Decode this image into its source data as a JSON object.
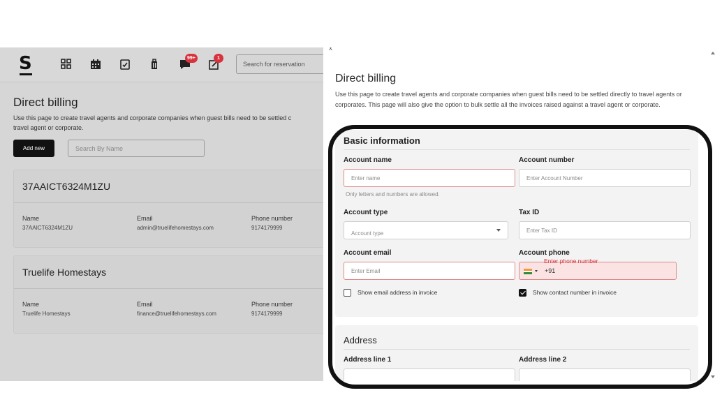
{
  "app": {
    "logo": "S",
    "search_reservation_placeholder": "Search for reservation",
    "nav_badges": {
      "messages": "99+",
      "tasks": "1"
    },
    "title": "Direct billing",
    "description_line1": "Use this page to create travel agents and corporate companies when guest bills need to be settled c",
    "description_line2": "travel agent or corporate.",
    "add_new_label": "Add new",
    "search_name_placeholder": "Search By Name",
    "accounts": [
      {
        "title": "37AAICT6324M1ZU",
        "name_label": "Name",
        "name": "37AAICT6324M1ZU",
        "email_label": "Email",
        "email": "admin@truelifehomestays.com",
        "phone_label": "Phone number",
        "phone": "9174179999"
      },
      {
        "title": "Truelife Homestays",
        "name_label": "Name",
        "name": "Truelife Homestays",
        "email_label": "Email",
        "email": "finance@truelifehomestays.com",
        "phone_label": "Phone number",
        "phone": "9174179999"
      }
    ]
  },
  "drawer": {
    "close": "x",
    "title": "Direct billing",
    "description": "Use this page to create travel agents and corporate companies when guest bills need to be settled directly to travel agents or corporates. This page will also give the option to bulk settle all the invoices raised against a travel agent or corporate.",
    "basic": {
      "title": "Basic information",
      "account_name_label": "Account name",
      "account_name_placeholder": "Enter name",
      "account_name_hint": "Only letters and numbers are allowed.",
      "account_number_label": "Account number",
      "account_number_placeholder": "Enter Account Number",
      "account_type_label": "Account type",
      "account_type_placeholder": "Account type",
      "tax_id_label": "Tax ID",
      "tax_id_placeholder": "Enter Tax ID",
      "account_email_label": "Account email",
      "account_email_placeholder": "Enter Email",
      "account_phone_label": "Account phone",
      "phone_error": "Enter phone number",
      "phone_code": "+91",
      "show_email_label": "Show email address in invoice",
      "show_email_checked": false,
      "show_contact_label": "Show contact number in invoice",
      "show_contact_checked": true
    },
    "address": {
      "title": "Address",
      "line1_label": "Address line 1",
      "line2_label": "Address line 2"
    }
  },
  "colors": {
    "error": "#d8323c",
    "primary": "#111111",
    "highlight_frame": "#111111"
  }
}
